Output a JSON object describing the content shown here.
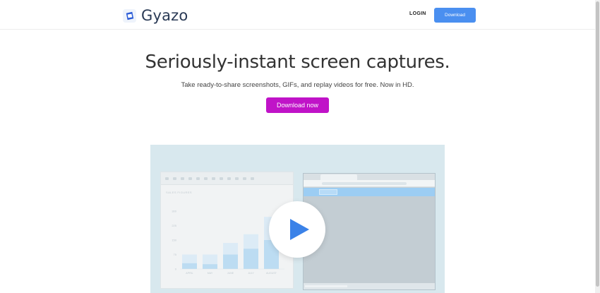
{
  "header": {
    "brand": "Gyazo",
    "login_label": "LOGIN",
    "download_label": "Download"
  },
  "hero": {
    "title": "Seriously-instant screen captures.",
    "subtitle": "Take ready-to-share screenshots, GIFs, and replay videos for free. Now in HD.",
    "cta_label": "Download now"
  },
  "colors": {
    "brand_blue": "#4a8ff0",
    "cta_magenta": "#c013c8",
    "play_blue": "#3b82e8",
    "video_bg": "#d8e8ee"
  },
  "icons": {
    "logo": "gyazo-logo-icon",
    "play": "play-icon"
  },
  "video_preview": {
    "chart_title": "SALES FIGURES",
    "chart_data": {
      "type": "bar",
      "categories": [
        "APRIL",
        "MAY",
        "JUNE",
        "JULY",
        "AUGUST"
      ],
      "y_ticks": [
        "0",
        "75",
        "150",
        "225",
        "300"
      ],
      "ylim": [
        0,
        300
      ],
      "series": [
        {
          "values": [
            30,
            25,
            75,
            105,
            150
          ]
        },
        {
          "values": [
            75,
            75,
            135,
            180,
            270
          ]
        }
      ]
    }
  }
}
